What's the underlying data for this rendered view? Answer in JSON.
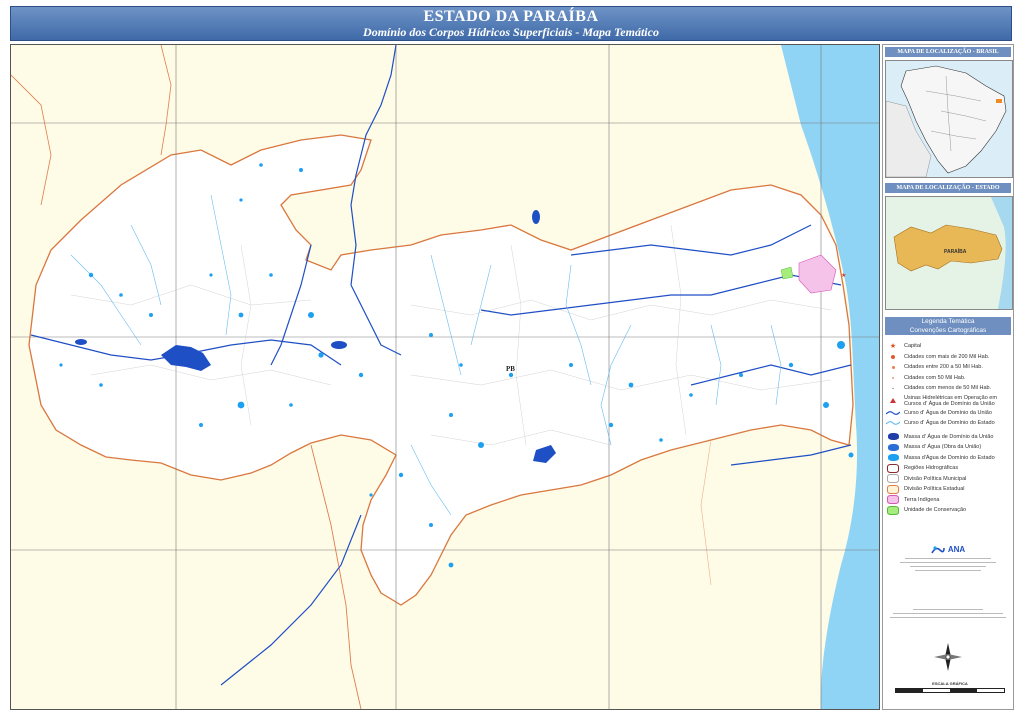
{
  "header": {
    "title": "ESTADO DA PARAÍBA",
    "subtitle": "Domínio dos Corpos Hídricos Superficiais - Mapa Temático"
  },
  "map": {
    "state_abbrev": "PB",
    "colors": {
      "land": "#fefbe6",
      "state": "#ffffff",
      "ocean": "#8fd3f5",
      "river_union": "#1f4fc4",
      "reservoir": "#1ea0f0",
      "border": "#e07e4e"
    }
  },
  "insets": {
    "brazil_title": "MAPA DE LOCALIZAÇÃO - BRASIL",
    "state_title": "MAPA DE LOCALIZAÇÃO - ESTADO",
    "state_label": "PARAÍBA"
  },
  "legend": {
    "title": "Legenda Temática",
    "subtitle": "Convenções Cartográficas",
    "items": [
      {
        "label": "Capital",
        "icon": "star-icon"
      },
      {
        "label": "Cidades com mais de 200 Mil Hab.",
        "icon": "dot-large-icon"
      },
      {
        "label": "Cidades entre 200 a 50 Mil Hab.",
        "icon": "dot-medium-icon"
      },
      {
        "label": "Cidades com 50 Mil Hab.",
        "icon": "dot-small-icon"
      },
      {
        "label": "Cidades com menos de 50 Mil Hab.",
        "icon": "dot-tiny-icon"
      },
      {
        "label": "Usinas Hidrelétricas em Operação em Cursos d' Água de Domínio da União",
        "icon": "triangle-icon"
      },
      {
        "label": "Curso d' Água de Domínio da União",
        "icon": "river-union-icon"
      },
      {
        "label": "Curso d' Água de Domínio do Estado",
        "icon": "river-state-icon"
      },
      {
        "label": "Massa d' Água de Domínio da União",
        "icon": "water-union-icon"
      },
      {
        "label": "Massa d' Água (Obra da União)",
        "icon": "water-works-icon"
      },
      {
        "label": "Massa d'Água de Domínio do Estado",
        "icon": "water-state-icon"
      },
      {
        "label": "Regiões Hidrográficas",
        "icon": "region-icon"
      },
      {
        "label": "Divisão Política Municipal",
        "icon": "municipal-icon"
      },
      {
        "label": "Divisão Política Estadual",
        "icon": "state-border-icon"
      },
      {
        "label": "Terra Indígena",
        "icon": "indigenous-icon"
      },
      {
        "label": "Unidade de Conservação",
        "icon": "conservation-icon"
      }
    ]
  },
  "credits": {
    "agency": "ANA"
  },
  "scale": {
    "label": "ESCALA GRÁFICA"
  }
}
